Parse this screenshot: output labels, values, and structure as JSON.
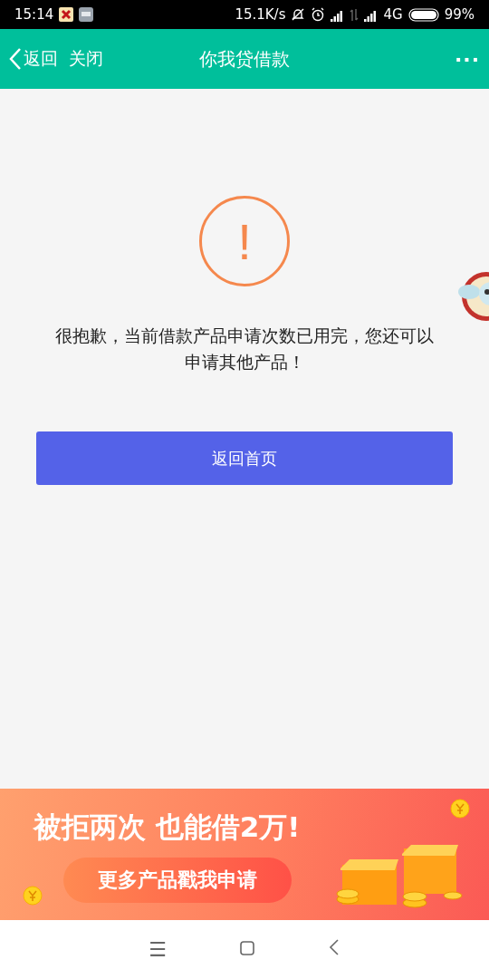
{
  "status_bar": {
    "time": "15:14",
    "speed": "15.1K/s",
    "network": "4G",
    "battery": "99%"
  },
  "header": {
    "back": "返回",
    "close": "关闭",
    "title": "你我贷借款",
    "more": "···"
  },
  "notice": {
    "icon": "!",
    "message": "很抱歉，当前借款产品申请次数已用完，您还可以申请其他产品！",
    "button": "返回首页"
  },
  "banner": {
    "headline": "被拒两次 也能借2万!",
    "button": "更多产品戳我申请"
  },
  "nav_bar": {
    "menu": "☰"
  }
}
